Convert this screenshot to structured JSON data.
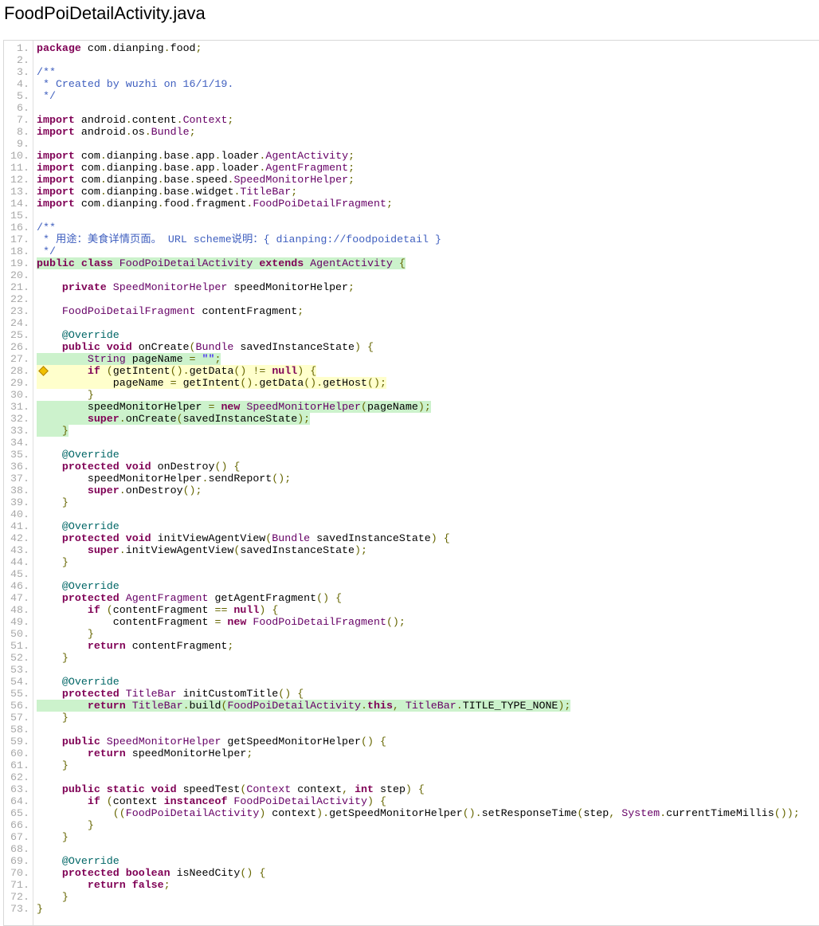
{
  "title": "FoodPoiDetailActivity.java",
  "colors": {
    "covered": "#ccf2cc",
    "partial": "#ffffcc"
  },
  "lines": [
    {
      "code": "package com.dianping.food;"
    },
    {
      "code": ""
    },
    {
      "code": "/**"
    },
    {
      "code": " * Created by wuzhi on 16/1/19."
    },
    {
      "code": " */"
    },
    {
      "code": ""
    },
    {
      "code": "import android.content.Context;"
    },
    {
      "code": "import android.os.Bundle;"
    },
    {
      "code": ""
    },
    {
      "code": "import com.dianping.base.app.loader.AgentActivity;"
    },
    {
      "code": "import com.dianping.base.app.loader.AgentFragment;"
    },
    {
      "code": "import com.dianping.base.speed.SpeedMonitorHelper;"
    },
    {
      "code": "import com.dianping.base.widget.TitleBar;"
    },
    {
      "code": "import com.dianping.food.fragment.FoodPoiDetailFragment;"
    },
    {
      "code": ""
    },
    {
      "code": "/**"
    },
    {
      "code": " * 用途：美食详情页面。 URL scheme说明：{ dianping://foodpoidetail }"
    },
    {
      "code": " */"
    },
    {
      "code": "public class FoodPoiDetailActivity extends AgentActivity {",
      "cov": "fc"
    },
    {
      "code": ""
    },
    {
      "code": "    private SpeedMonitorHelper speedMonitorHelper;"
    },
    {
      "code": ""
    },
    {
      "code": "    FoodPoiDetailFragment contentFragment;"
    },
    {
      "code": ""
    },
    {
      "code": "    @Override"
    },
    {
      "code": "    public void onCreate(Bundle savedInstanceState) {"
    },
    {
      "code": "        String pageName = \"\";",
      "cov": "fc"
    },
    {
      "code": "        if (getIntent().getData() != null) {",
      "cov": "pc",
      "branch": true
    },
    {
      "code": "            pageName = getIntent().getData().getHost();",
      "cov": "pc"
    },
    {
      "code": "        }"
    },
    {
      "code": "        speedMonitorHelper = new SpeedMonitorHelper(pageName);",
      "cov": "fc"
    },
    {
      "code": "        super.onCreate(savedInstanceState);",
      "cov": "fc"
    },
    {
      "code": "    }",
      "cov": "fc"
    },
    {
      "code": ""
    },
    {
      "code": "    @Override"
    },
    {
      "code": "    protected void onDestroy() {"
    },
    {
      "code": "        speedMonitorHelper.sendReport();"
    },
    {
      "code": "        super.onDestroy();"
    },
    {
      "code": "    }"
    },
    {
      "code": ""
    },
    {
      "code": "    @Override"
    },
    {
      "code": "    protected void initViewAgentView(Bundle savedInstanceState) {"
    },
    {
      "code": "        super.initViewAgentView(savedInstanceState);"
    },
    {
      "code": "    }"
    },
    {
      "code": ""
    },
    {
      "code": "    @Override"
    },
    {
      "code": "    protected AgentFragment getAgentFragment() {"
    },
    {
      "code": "        if (contentFragment == null) {"
    },
    {
      "code": "            contentFragment = new FoodPoiDetailFragment();"
    },
    {
      "code": "        }"
    },
    {
      "code": "        return contentFragment;"
    },
    {
      "code": "    }"
    },
    {
      "code": ""
    },
    {
      "code": "    @Override"
    },
    {
      "code": "    protected TitleBar initCustomTitle() {"
    },
    {
      "code": "        return TitleBar.build(FoodPoiDetailActivity.this, TitleBar.TITLE_TYPE_NONE);",
      "cov": "fc"
    },
    {
      "code": "    }"
    },
    {
      "code": ""
    },
    {
      "code": "    public SpeedMonitorHelper getSpeedMonitorHelper() {"
    },
    {
      "code": "        return speedMonitorHelper;"
    },
    {
      "code": "    }"
    },
    {
      "code": ""
    },
    {
      "code": "    public static void speedTest(Context context, int step) {"
    },
    {
      "code": "        if (context instanceof FoodPoiDetailActivity) {"
    },
    {
      "code": "            ((FoodPoiDetailActivity) context).getSpeedMonitorHelper().setResponseTime(step, System.currentTimeMillis());"
    },
    {
      "code": "        }"
    },
    {
      "code": "    }"
    },
    {
      "code": ""
    },
    {
      "code": "    @Override"
    },
    {
      "code": "    protected boolean isNeedCity() {"
    },
    {
      "code": "        return false;"
    },
    {
      "code": "    }"
    },
    {
      "code": "}"
    }
  ]
}
